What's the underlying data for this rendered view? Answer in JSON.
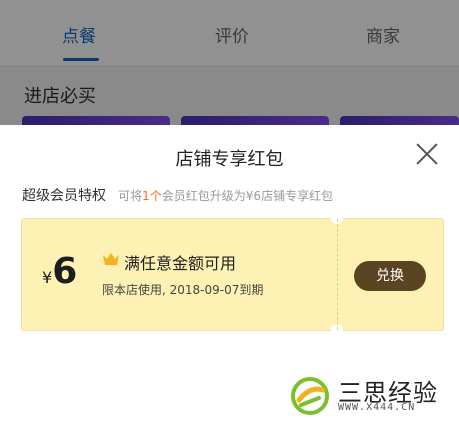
{
  "tabs": [
    {
      "label": "点餐",
      "active": true
    },
    {
      "label": "评价",
      "active": false
    },
    {
      "label": "商家",
      "active": false
    }
  ],
  "section": {
    "title": "进店必买"
  },
  "sheet": {
    "title": "店铺专享红包",
    "privilege": {
      "title": "超级会员特权",
      "desc_prefix": "可将",
      "desc_highlight": "1个",
      "desc_suffix": "会员红包升级为¥6店铺专享红包"
    },
    "coupon": {
      "currency": "¥",
      "amount": "6",
      "condition": "满任意金额可用",
      "validity": "限本店使用, 2018-09-07到期",
      "redeem_label": "兑换"
    }
  },
  "watermark": {
    "title": "三思经验",
    "url": "WWW.X444.CN"
  },
  "colors": {
    "accent": "#0a3a6e",
    "coupon_bg": "#fdf1b4",
    "redeem_bg": "#5a4422",
    "highlight": "#ff6a1a"
  }
}
